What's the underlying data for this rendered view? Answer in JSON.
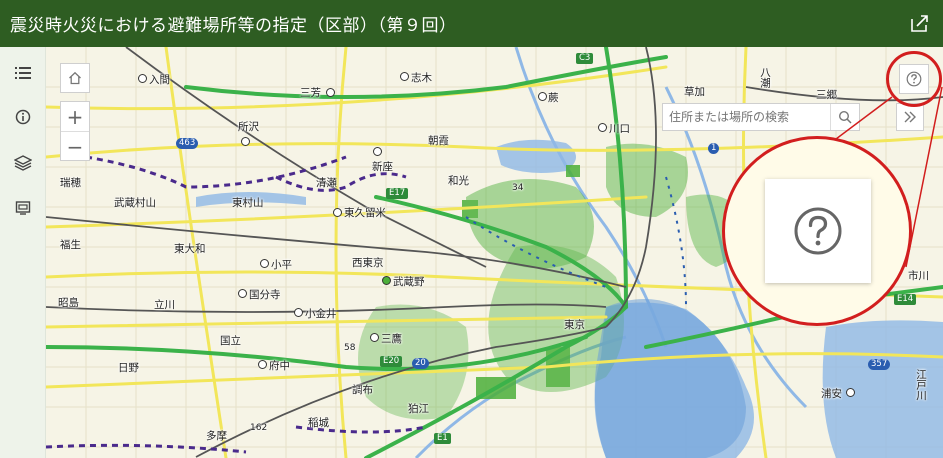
{
  "header": {
    "title": "震災時火災における避難場所等の指定（区部）（第９回）",
    "share_icon": "share-icon"
  },
  "sidebar": {
    "items": [
      {
        "name": "legend-list-icon"
      },
      {
        "name": "info-icon"
      },
      {
        "name": "layers-icon"
      },
      {
        "name": "basemap-gallery-icon"
      }
    ]
  },
  "map": {
    "search": {
      "placeholder": "住所または場所の検索"
    },
    "zoom_in": "+",
    "zoom_out": "−",
    "places": [
      {
        "label": "入間"
      },
      {
        "label": "三芳"
      },
      {
        "label": "志木"
      },
      {
        "label": "蕨"
      },
      {
        "label": "草加"
      },
      {
        "label": "八潮"
      },
      {
        "label": "三郷"
      },
      {
        "label": "所沢"
      },
      {
        "label": "朝霞"
      },
      {
        "label": "川口"
      },
      {
        "label": "瑞穂"
      },
      {
        "label": "清瀬"
      },
      {
        "label": "新座"
      },
      {
        "label": "和光"
      },
      {
        "label": "武蔵村山"
      },
      {
        "label": "東村山"
      },
      {
        "label": "東久留米"
      },
      {
        "label": "東大和"
      },
      {
        "label": "福生"
      },
      {
        "label": "小平"
      },
      {
        "label": "西東京"
      },
      {
        "label": "武蔵野"
      },
      {
        "label": "立川"
      },
      {
        "label": "国分寺"
      },
      {
        "label": "昭島"
      },
      {
        "label": "小金井"
      },
      {
        "label": "国立"
      },
      {
        "label": "三鷹"
      },
      {
        "label": "日野"
      },
      {
        "label": "府中"
      },
      {
        "label": "調布"
      },
      {
        "label": "狛江"
      },
      {
        "label": "稲城"
      },
      {
        "label": "多摩"
      },
      {
        "label": "東京"
      },
      {
        "label": "浦安"
      },
      {
        "label": "江戸川"
      },
      {
        "label": "市川"
      }
    ],
    "roads": [
      "C3",
      "463",
      "E17",
      "E20",
      "20",
      "E1",
      "E14",
      "357",
      "1"
    ],
    "spot_heights": [
      "34",
      "58",
      "162"
    ]
  },
  "help": {
    "icon": "help-icon"
  },
  "colors": {
    "header": "#2e5d22",
    "callout_ring": "#d21e1e",
    "expressway": "#3bb24a",
    "route": "#f2e65a",
    "evac_area": "#4caf3a",
    "water": "#8fb8e6"
  }
}
